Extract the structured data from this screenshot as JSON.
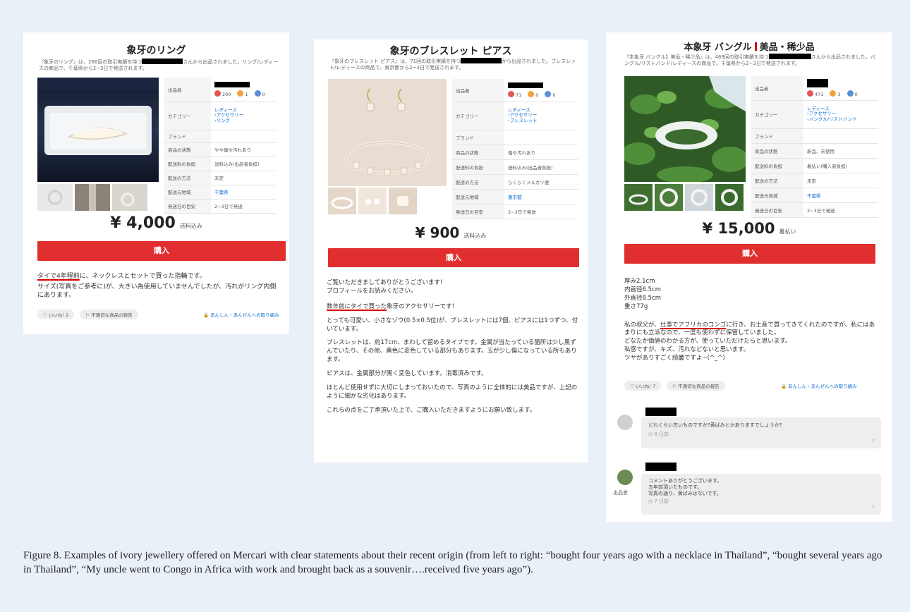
{
  "listings": [
    {
      "title": "象牙のリング",
      "desc_pre": "『象牙のリング』は、266回の取引実績を持つ",
      "desc_post": "さんから出品されました。リング/レディースの商品で、千葉県から2~3日で発送されます。",
      "spec": {
        "seller_key": "出品者",
        "ratings": [
          "200",
          "1",
          "0"
        ],
        "category_key": "カテゴリー",
        "categories": [
          "レディース",
          "アクセサリー",
          "リング"
        ],
        "brand_key": "ブランド",
        "condition_key": "商品の状態",
        "condition": "やや傷や汚れあり",
        "shipping_key": "配送料の負担",
        "shipping": "送料込み(出品者負担)",
        "method_key": "配送の方法",
        "method": "未定",
        "origin_key": "配送元地域",
        "origin": "千葉県",
        "days_key": "発送日の目安",
        "days": "2~3日で発送"
      },
      "price": "¥ 4,000",
      "price_note": "送料込み",
      "buy": "購入",
      "body": {
        "line1_hl": "タイで4年程前",
        "line1_rest": "に、ネックレスとセットで買った指輪です。",
        "line2": "サイズ(写真をご参考に)が、大きい為使用していませんでしたが、汚れがリング内側にあります。"
      },
      "like": "♡ いいね! 2",
      "report": "⚐ 不適切な商品の報告",
      "safe": "あんしん・あんぜんへの取り組み"
    },
    {
      "title": "象牙のブレスレット ピアス",
      "desc_pre": "『象牙のブレスレット ピアス』は、71回の取引実績を持つ",
      "desc_post": "から出品されました。ブレスレット/レディースの商品で、東京都から2~3日で発送されます。",
      "spec": {
        "seller_key": "出品者",
        "ratings": [
          "71",
          "0",
          "0"
        ],
        "category_key": "カテゴリー",
        "categories": [
          "レディース",
          "アクセサリー",
          "ブレスレット"
        ],
        "brand_key": "ブランド",
        "condition_key": "商品の状態",
        "condition": "傷や汚れあり",
        "shipping_key": "配送料の負担",
        "shipping": "送料込み(出品者負担)",
        "method_key": "配送の方法",
        "method": "らくらくメルカリ便",
        "origin_key": "配送元地域",
        "origin": "東京都",
        "days_key": "発送日の目安",
        "days": "2~3日で発送"
      },
      "price": "¥ 900",
      "price_note": "送料込み",
      "buy": "購入",
      "body": {
        "p1": "ご覧いただきましてありがとうございます!",
        "p1b": "プロフィールをお読みください。",
        "p2_hl": "数年前にタイで買った",
        "p2_rest": "象牙のアクセサリーです!",
        "p3": "とっても可愛い、小さなゾウ(0.5×0.5位)が、ブレスレットには7個、ピアスには1つずつ、付いています。",
        "p4": "ブレスレットは、約17cm、まわして留めるタイプです。金属が当たっている箇所は少し黒ずんでいたり、その他、黄色に変色している部分もあります。玉が少し傷になっている所もあります。",
        "p5": "ピアスは、金属部分が黒く変色しています。消毒済みです。",
        "p6": "ほとんど使用せずに大切にしまっておいたので、写真のように全体的には美品ですが、上記のように細かな劣化はあります。",
        "p7": "これらの点をご了承頂いた上で、ご購入いただきますようにお願い致します。"
      }
    },
    {
      "title_a": "本象牙 バングル",
      "title_b": "美品・稀少品",
      "desc_pre": "『本象牙 バングル】美品・稀少品』は、469回の取引実績を持つ",
      "desc_post": "さんから出品されました。バングル/リストバンド/レディースの商品で、千葉県から2~3日で発送されます。",
      "spec": {
        "seller_key": "出品者",
        "ratings": [
          "471",
          "3",
          "0"
        ],
        "category_key": "カテゴリー",
        "categories": [
          "レディース",
          "アクセサリー",
          "バングル/リストバンド"
        ],
        "brand_key": "ブランド",
        "condition_key": "商品の状態",
        "condition": "新品、未使用",
        "shipping_key": "配送料の負担",
        "shipping": "着払い(購入者負担)",
        "method_key": "配送の方法",
        "method": "未定",
        "origin_key": "配送元地域",
        "origin": "千葉県",
        "days_key": "発送日の目安",
        "days": "2~3日で発送"
      },
      "price": "¥ 15,000",
      "price_note": "着払い",
      "buy": "購入",
      "body": {
        "m1": "厚み2.1cm",
        "m2": "内直径6.5cm",
        "m3": "外直径8.5cm",
        "m4": "重さ77g",
        "s1_pre": "私の叔父が、",
        "s1_hl": "仕事でアフリカのコンゴ",
        "s1_rest": "に行き、お土産で買ってきてくれたのですが、私にはあまりにも立派なので、一度も使わずに保管していました。",
        "s2": "どなたか価値のわかる方が、使っていただけたらと思います。",
        "s3": "私感ですが、キズ、汚れなどないと思います。",
        "s4": "ツヤがありすごく綺麗ですよ~(^_^)"
      },
      "like": "♡ いいね! 7",
      "report": "⚐ 不適切な商品の報告",
      "safe": "あんしん・あんぜんへの取り組み",
      "comments": [
        {
          "text": "どれくらい古いものですか?黄ばみとかありますでしょうか?",
          "time": "◷ 8 日前"
        },
        {
          "tag": "出品者",
          "lines": [
            "コメントありがとうございます。",
            "五年前頂いたものです。",
            "写真の通り、黄ばみはないです。"
          ],
          "time": "◷ 7 日前"
        }
      ]
    }
  ],
  "caption": "Figure 8. Examples of ivory jewellery offered on Mercari with clear statements about their recent origin (from left to right: “bought four years ago with a necklace in Thailand”, “bought several years ago in Thailand”, “My uncle went to Congo in Africa with work and brought back as a souvenir….received five years ago”)."
}
